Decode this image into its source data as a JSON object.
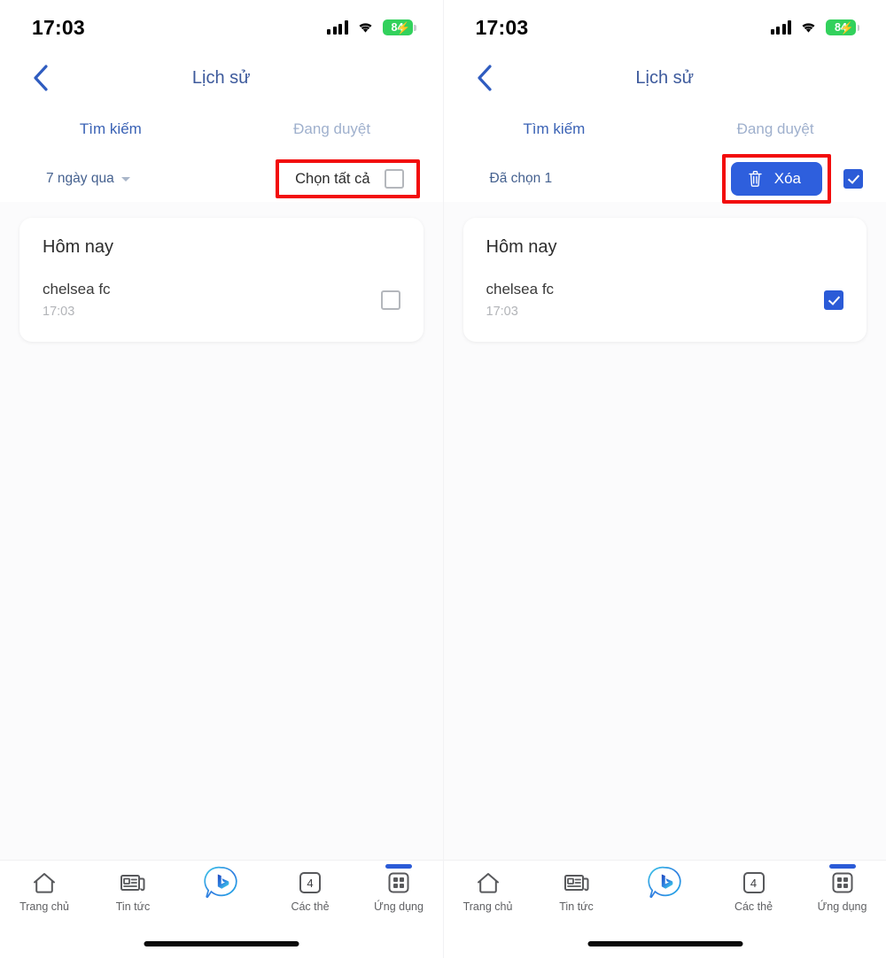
{
  "status_bar": {
    "time": "17:03",
    "cellular_icon": "signal-bars-icon",
    "wifi_icon": "wifi-icon",
    "battery_level": "84",
    "battery_charging_icon": "bolt-icon"
  },
  "header": {
    "back_icon": "chevron-left-icon",
    "title": "Lịch sử"
  },
  "tabs": [
    {
      "label": "Tìm kiếm",
      "active": true
    },
    {
      "label": "Đang duyệt",
      "active": false
    }
  ],
  "left_panel": {
    "toolbar": {
      "range_label": "7 ngày qua",
      "range_caret_icon": "chevron-down-icon",
      "select_all_label": "Chọn tất cả",
      "select_all_checked": false
    },
    "card": {
      "group_title": "Hôm nay",
      "items": [
        {
          "query": "chelsea fc",
          "time": "17:03",
          "checked": false
        }
      ]
    }
  },
  "right_panel": {
    "toolbar": {
      "selected_label": "Đã chọn 1",
      "delete_label": "Xóa",
      "delete_icon": "trash-icon",
      "select_all_checked": true
    },
    "card": {
      "group_title": "Hôm nay",
      "items": [
        {
          "query": "chelsea fc",
          "time": "17:03",
          "checked": true
        }
      ]
    }
  },
  "bottom_nav": [
    {
      "label": "Trang chủ",
      "icon": "home-icon",
      "active": false
    },
    {
      "label": "Tin tức",
      "icon": "news-icon",
      "active": false
    },
    {
      "label": "",
      "icon": "bing-chat-icon",
      "active": false
    },
    {
      "label": "Các thẻ",
      "icon": "tabs-count-icon",
      "badge": "4",
      "active": false
    },
    {
      "label": "Ứng dụng",
      "icon": "apps-grid-icon",
      "active": true
    }
  ],
  "colors": {
    "accent_blue": "#2b5bd7",
    "highlight_red": "#f20c0c",
    "title_blue": "#3d5a9c",
    "battery_green": "#32d15c"
  }
}
